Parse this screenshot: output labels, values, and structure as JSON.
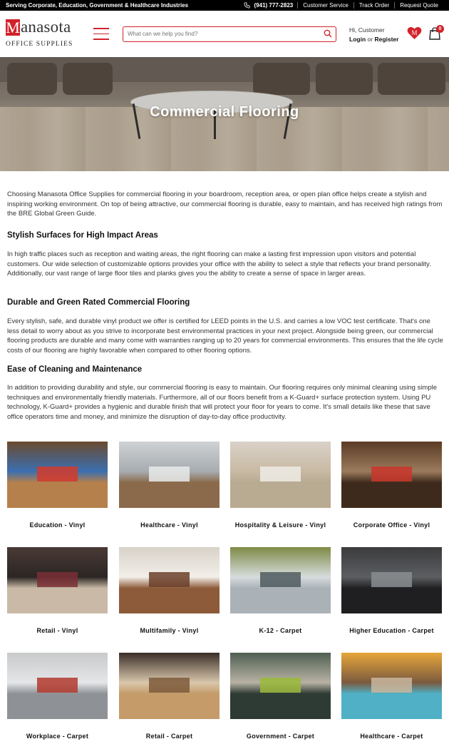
{
  "topbar": {
    "tagline": "Serving Corporate, Education, Government & Healthcare Industries",
    "phone": "(941) 777-2823",
    "links": [
      "Customer Service",
      "Track Order",
      "Request Quote"
    ]
  },
  "header": {
    "logo_letter": "M",
    "logo_word": "anasota",
    "logo_sub": "OFFICE SUPPLIES",
    "search_placeholder": "What can we help you find?",
    "greeting": "Hi, Customer",
    "login": "Login",
    "or": "or",
    "register": "Register",
    "cart_count": "0",
    "icons": [
      "menu-icon",
      "search-icon",
      "heart-icon",
      "bag-icon",
      "phone-icon"
    ]
  },
  "hero": {
    "title": "Commercial Flooring"
  },
  "content": {
    "intro": "Choosing Manasota Office Supplies for commercial flooring in your boardroom, reception area, or open plan office helps create a stylish and inspiring working environment. On top of being attractive, our commercial flooring is durable, easy to maintain, and has received high ratings from the BRE Global Green Guide.",
    "sections": [
      {
        "heading": "Stylish Surfaces for High Impact Areas",
        "body": "In high traffic places such as reception and waiting areas, the right flooring can make a lasting first impression upon visitors and potential customers. Our wide selection of customizable options provides your office with the ability to select a style that reflects your brand personality. Additionally, our vast range of large floor tiles and planks gives you the ability to create a sense of space in larger areas."
      },
      {
        "heading": "Durable and Green Rated Commercial Flooring",
        "body": "Every stylish, safe, and durable vinyl product we offer is certified for LEED points in the U.S. and carries a low VOC test certificate. That's one less detail to worry about as you strive to incorporate best environmental practices in your next project. Alongside being green, our commercial flooring products are durable and many come with warranties ranging up to 20 years for commercial environments. This ensures that the life cycle costs of our flooring are highly favorable when compared to other flooring options."
      },
      {
        "heading": "Ease of Cleaning and Maintenance",
        "body": "In addition to providing durability and style, our commercial flooring is easy to maintain. Our flooring requires only minimal cleaning using simple techniques and environmentally friendly materials. Furthermore, all of our floors benefit from a K-Guard+ surface protection system. Using PU technology, K-Guard+ provides a hygienic and durable finish that will protect your floor for years to come. It's small details like these that save office operators time and money, and minimize the disruption of day-to-day office productivity."
      }
    ]
  },
  "categories": [
    {
      "label": "Education - Vinyl",
      "colors": [
        "#6b4a2f",
        "#b5804c",
        "#d33a2c",
        "#3b6fb0"
      ]
    },
    {
      "label": "Healthcare - Vinyl",
      "colors": [
        "#cfd2d4",
        "#8a6a4b",
        "#e9eaea",
        "#a7acb0"
      ]
    },
    {
      "label": "Hospitality & Leisure - Vinyl",
      "colors": [
        "#d9d2c8",
        "#b9aa92",
        "#efece6",
        "#c8b9a3"
      ]
    },
    {
      "label": "Corporate Office - Vinyl",
      "colors": [
        "#5a3b25",
        "#3e2a1c",
        "#c9362c",
        "#9b7b5c"
      ]
    },
    {
      "label": "Retail - Vinyl",
      "colors": [
        "#4a3a35",
        "#c9b9a6",
        "#7a2f36",
        "#2b2624"
      ]
    },
    {
      "label": "Multifamily - Vinyl",
      "colors": [
        "#d8d2c8",
        "#8d5b3a",
        "#6b3f2a",
        "#f2efe9"
      ]
    },
    {
      "label": "K-12 - Carpet",
      "colors": [
        "#7d8a45",
        "#aab2b8",
        "#4f5a5f",
        "#d7dcdd"
      ]
    },
    {
      "label": "Higher Education - Carpet",
      "colors": [
        "#3b3b3d",
        "#1f1f21",
        "#8a8d90",
        "#5c5e61"
      ]
    },
    {
      "label": "Workplace - Carpet",
      "colors": [
        "#c7c9cb",
        "#8e9296",
        "#b23a2e",
        "#e4e6e7"
      ]
    },
    {
      "label": "Retail - Carpet",
      "colors": [
        "#3a2e28",
        "#c59b6a",
        "#7d5a3b",
        "#d9c7ac"
      ]
    },
    {
      "label": "Government - Carpet",
      "colors": [
        "#4f5f52",
        "#2e3a34",
        "#9ab93a",
        "#b8b2a4"
      ]
    },
    {
      "label": "Healthcare - Carpet",
      "colors": [
        "#e6a63a",
        "#4fb0c6",
        "#c9b79f",
        "#7b5a3e"
      ]
    }
  ],
  "colors": {
    "brand_red": "#d1222a",
    "topbar_bg": "#000000",
    "text": "#333333"
  }
}
